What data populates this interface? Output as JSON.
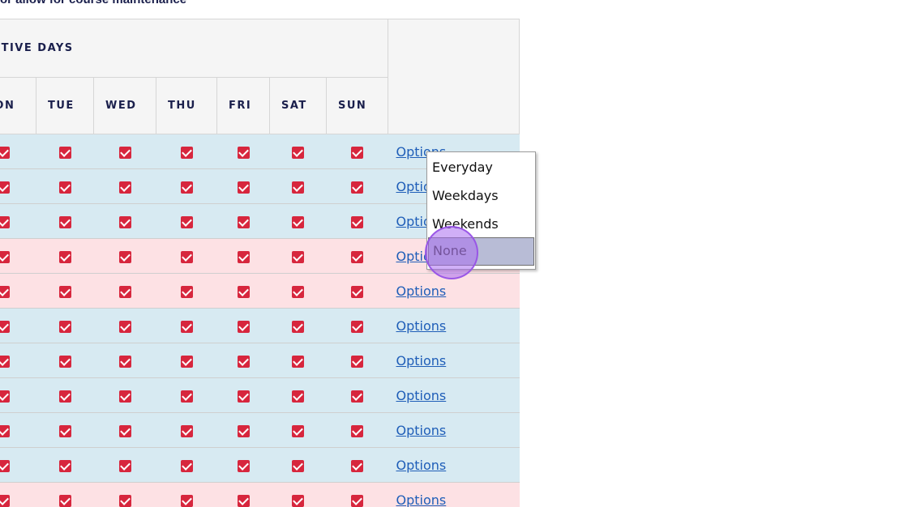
{
  "page": {
    "top_note": "or allow for course maintenance"
  },
  "table": {
    "group_header": "ACTIVE DAYS",
    "days": [
      "MON",
      "TUE",
      "WED",
      "THU",
      "FRI",
      "SAT",
      "SUN"
    ],
    "rows": [
      {
        "tint": "blue",
        "options_label": "Options"
      },
      {
        "tint": "blue",
        "options_label": "Options"
      },
      {
        "tint": "blue",
        "options_label": "Options"
      },
      {
        "tint": "pink",
        "options_label": "Options"
      },
      {
        "tint": "pink",
        "options_label": "Options"
      },
      {
        "tint": "blue",
        "options_label": "Options"
      },
      {
        "tint": "blue",
        "options_label": "Options"
      },
      {
        "tint": "blue",
        "options_label": "Options"
      },
      {
        "tint": "blue",
        "options_label": "Options"
      },
      {
        "tint": "blue",
        "options_label": "Options"
      },
      {
        "tint": "pink",
        "options_label": "Options"
      }
    ],
    "checkbox_state": "checked"
  },
  "dropdown": {
    "items": [
      "Everyday",
      "Weekdays",
      "Weekends",
      "None"
    ],
    "highlighted": "None"
  },
  "colors": {
    "row_blue": "#d7eaf2",
    "row_pink": "#fde1e4",
    "checkbox": "#d7263d",
    "link": "#1f5eb8",
    "header_text": "#1a1f4c",
    "highlight": "#b8bcd6",
    "cursor": "#aa6ef0"
  },
  "icons": {
    "checkbox": "checked-checkbox-icon"
  }
}
